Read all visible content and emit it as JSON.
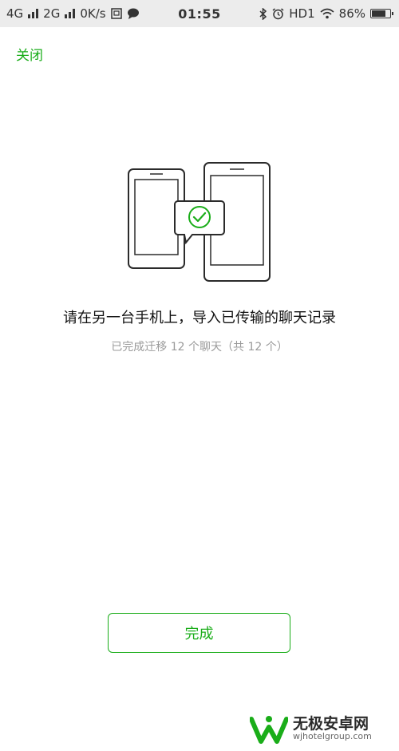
{
  "status_bar": {
    "network_1": "4G",
    "network_2": "2G",
    "speed": "0K/s",
    "time": "01:55",
    "hd_label": "HD1",
    "battery_text": "86%",
    "battery_level": 0.86,
    "icons": [
      "signal-icon",
      "signal-icon",
      "screenshot-icon",
      "message-icon",
      "bluetooth-icon",
      "alarm-icon",
      "wifi-icon",
      "battery-icon"
    ]
  },
  "header": {
    "close_label": "关闭"
  },
  "illustration": {
    "icon": "phones-transfer-check-icon"
  },
  "main": {
    "headline": "请在另一台手机上，导入已传输的聊天记录",
    "subtext": "已完成迁移 12 个聊天（共 12 个）"
  },
  "footer": {
    "done_label": "完成"
  },
  "watermark": {
    "brand": "无极安卓网",
    "domain": "wjhotelgroup.com"
  },
  "colors": {
    "accent": "#1aad19",
    "text": "#111111",
    "muted": "#9a9a9a",
    "status_bar_bg": "#ececec"
  }
}
